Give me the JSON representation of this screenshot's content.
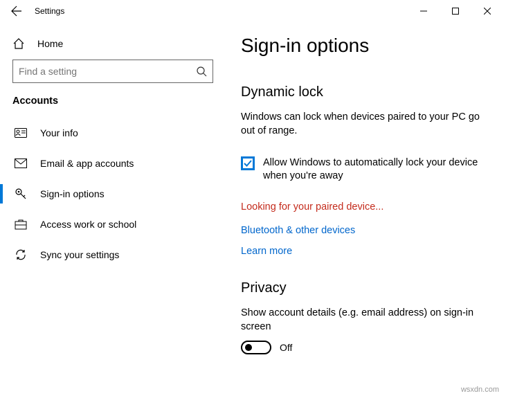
{
  "window": {
    "title": "Settings"
  },
  "sidebar": {
    "home_label": "Home",
    "search_placeholder": "Find a setting",
    "section": "Accounts",
    "items": [
      {
        "label": "Your info"
      },
      {
        "label": "Email & app accounts"
      },
      {
        "label": "Sign-in options"
      },
      {
        "label": "Access work or school"
      },
      {
        "label": "Sync your settings"
      }
    ]
  },
  "main": {
    "title": "Sign-in options",
    "dynamic_lock": {
      "heading": "Dynamic lock",
      "desc": "Windows can lock when devices paired to your PC go out of range.",
      "checkbox_label": "Allow Windows to automatically lock your device when you're away",
      "status": "Looking for your paired device...",
      "link_bluetooth": "Bluetooth & other devices",
      "link_learn": "Learn more"
    },
    "privacy": {
      "heading": "Privacy",
      "desc": "Show account details (e.g. email address) on sign-in screen",
      "toggle_state": "Off"
    }
  },
  "watermark": "wsxdn.com"
}
